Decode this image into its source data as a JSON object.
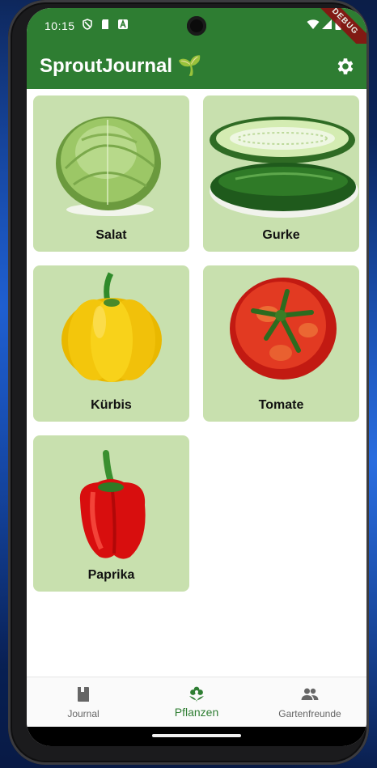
{
  "status_bar": {
    "time": "10:15"
  },
  "debug_banner": "DEBUG",
  "app_bar": {
    "title": "SproutJournal 🌱"
  },
  "plants": [
    {
      "name": "Salat"
    },
    {
      "name": "Gurke"
    },
    {
      "name": "Kürbis"
    },
    {
      "name": "Tomate"
    },
    {
      "name": "Paprika"
    }
  ],
  "bottom_nav": {
    "items": [
      {
        "label": "Journal",
        "icon": "book-icon"
      },
      {
        "label": "Pflanzen",
        "icon": "flower-icon",
        "active": true
      },
      {
        "label": "Gartenfreunde",
        "icon": "people-icon"
      }
    ]
  },
  "colors": {
    "primary": "#2e7d32",
    "card": "#c8e0ae"
  }
}
